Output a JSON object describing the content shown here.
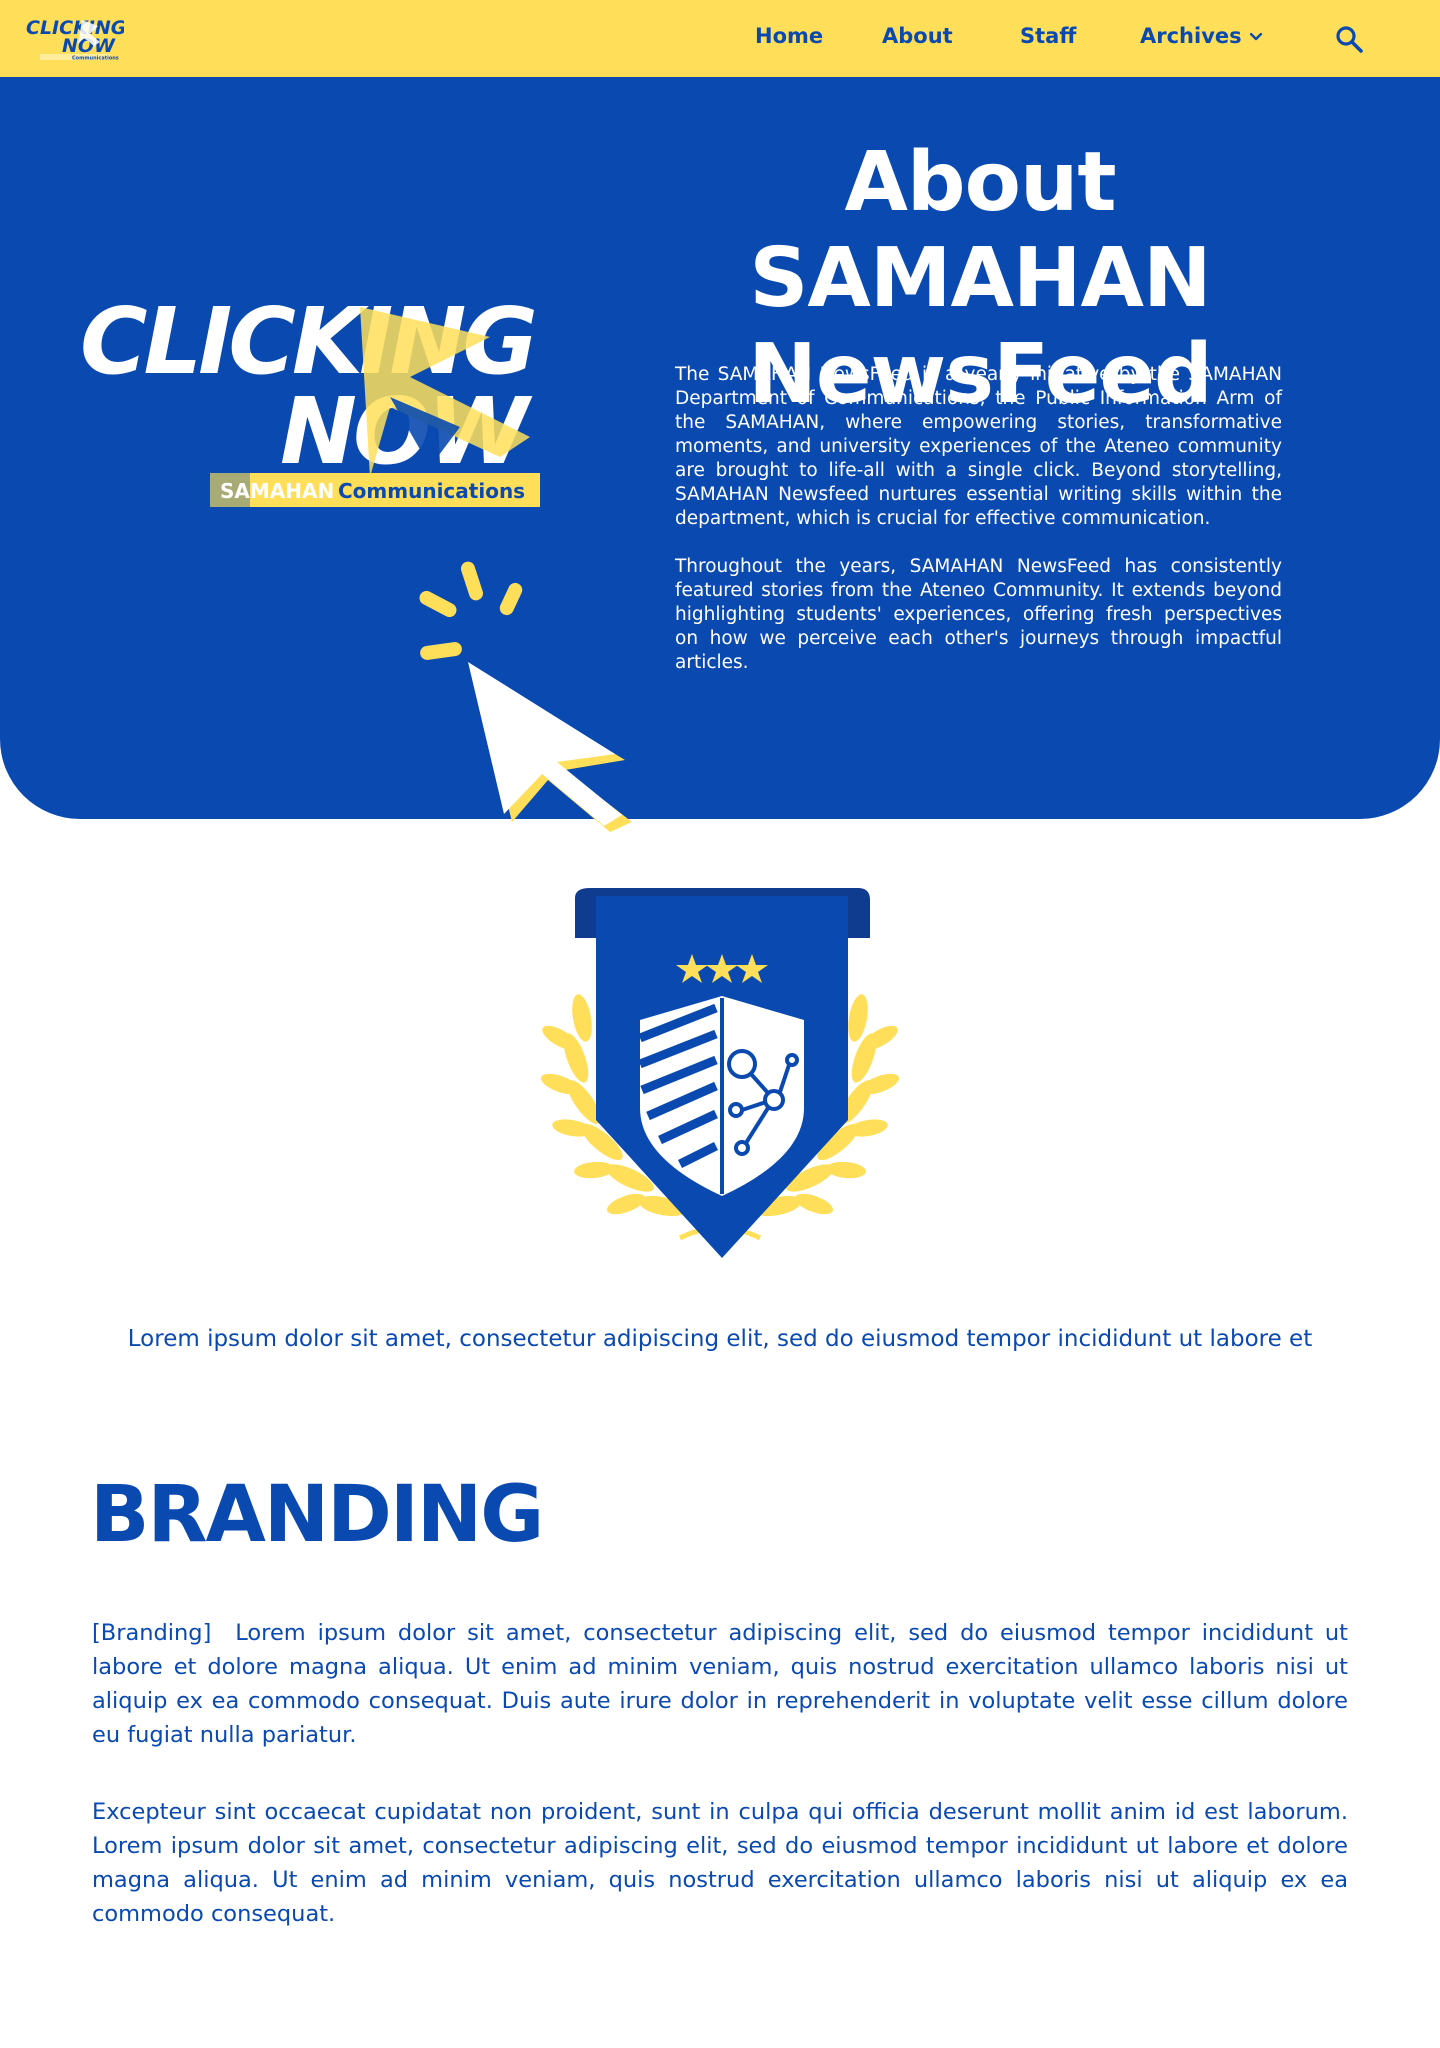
{
  "nav": {
    "logo_text_top": "CLICKING",
    "logo_text_bottom": "NOW",
    "logo_sub": "Communications",
    "home": "Home",
    "about": "About",
    "staff": "Staff",
    "archives": "Archives",
    "search_icon": "search-icon"
  },
  "hero": {
    "logo_top": "CLICKING",
    "logo_bottom": "NOW",
    "logo_badge_left": "SAMAHAN",
    "logo_badge_right": "Communications",
    "title_line1": "About SAMAHAN",
    "title_line2": "NewsFeed",
    "paragraph1": "The SAMAHAN NewsFeed is a yearly initiative by the SAMAHAN Department of Communications, the Public Information Arm of the SAMAHAN, where empowering stories, transformative moments, and university experiences of the Ateneo community are brought to life-all with a single click. Beyond storytelling, SAMAHAN Newsfeed nurtures essential writing skills within the department, which is crucial for effective communication.",
    "paragraph2": "Throughout the years, SAMAHAN NewsFeed has consistently featured stories from the Ateneo Community. It extends beyond highlighting students' experiences, offering fresh perspectives on how we perceive each other's journeys through impactful articles."
  },
  "emblem": {
    "icon": "shield-laurel-emblem"
  },
  "tagline": "Lorem ipsum dolor sit amet, consectetur adipiscing elit, sed do eiusmod tempor incididunt ut labore et",
  "branding": {
    "title": "BRANDING",
    "tag": "[Branding]",
    "paragraph1": "Lorem ipsum dolor sit amet, consectetur adipiscing elit, sed do eiusmod tempor incididunt ut labore et dolore magna aliqua. Ut enim ad minim veniam, quis nostrud exercitation ullamco laboris nisi ut aliquip ex ea commodo consequat. Duis aute irure dolor in reprehenderit in voluptate velit esse cillum dolore eu fugiat nulla pariatur.",
    "paragraph2": "Excepteur sint occaecat cupidatat non proident, sunt in culpa qui officia deserunt mollit anim id est laborum. Lorem ipsum dolor sit amet, consectetur adipiscing elit, sed do eiusmod tempor incididunt ut labore et dolore magna aliqua. Ut enim ad minim veniam, quis nostrud exercitation ullamco laboris nisi ut aliquip ex ea commodo consequat."
  },
  "colors": {
    "brand_blue": "#0a4ab0",
    "brand_yellow": "#ffdf5a",
    "white": "#ffffff"
  }
}
